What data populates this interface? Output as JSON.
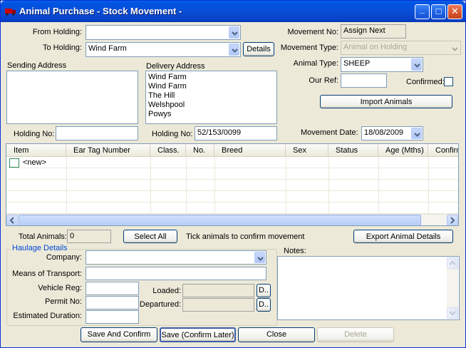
{
  "window": {
    "title": "Animal Purchase - Stock Movement -",
    "minimize": "_",
    "maximize": "□",
    "close": "✕"
  },
  "from_holding": {
    "label": "From Holding:",
    "value": ""
  },
  "to_holding": {
    "label": "To Holding:",
    "value": "Wind Farm",
    "details_label": "Details"
  },
  "movement_no": {
    "label": "Movement No:",
    "value": "Assign Next"
  },
  "movement_type": {
    "label": "Movement Type:",
    "value": "Animal on Holding"
  },
  "animal_type": {
    "label": "Animal Type:",
    "value": "SHEEP"
  },
  "our_ref": {
    "label": "Our Ref:",
    "value": ""
  },
  "confirmed": {
    "label": "Confirmed:",
    "checked": false
  },
  "import_animals": {
    "label": "Import Animals"
  },
  "sending_address": {
    "label": "Sending Address",
    "lines": []
  },
  "delivery_address": {
    "label": "Delivery Address",
    "lines": [
      "Wind Farm",
      "Wind Farm",
      "The Hill",
      "Welshpool",
      "Powys"
    ]
  },
  "sending_holding_no": {
    "label": "Holding No:",
    "value": ""
  },
  "delivery_holding_no": {
    "label": "Holding No:",
    "value": "52/153/0099"
  },
  "movement_date": {
    "label": "Movement Date:",
    "value": "18/08/2009"
  },
  "grid": {
    "columns": [
      "Item",
      "Ear Tag Number",
      "Class.",
      "No.",
      "Breed",
      "Sex",
      "Status",
      "Age (Mths)",
      "Confirm"
    ],
    "new_row_label": "<new>"
  },
  "total_animals": {
    "label": "Total Animals:",
    "value": "0"
  },
  "select_all": {
    "label": "Select All"
  },
  "hint": "Tick animals to confirm movement",
  "export_details": {
    "label": "Export Animal Details"
  },
  "haulage": {
    "title": "Haulage Details",
    "company_label": "Company:",
    "company_value": "",
    "transport_label": "Means of Transport:",
    "transport_value": "",
    "vehicle_reg_label": "Vehicle Reg:",
    "vehicle_reg_value": "",
    "permit_no_label": "Permit No:",
    "permit_no_value": "",
    "duration_label": "Estimated Duration:",
    "duration_value": "",
    "loaded_label": "Loaded:",
    "loaded_value": "",
    "departured_label": "Departured:",
    "departured_value": "",
    "date_btn_label": "D.."
  },
  "notes": {
    "label": "Notes:",
    "value": ""
  },
  "buttons": {
    "save_confirm": "Save And Confirm",
    "save_later": "Save (Confirm Later)",
    "close": "Close",
    "delete": "Delete"
  },
  "colors": {
    "title_bar": "#0054e3",
    "window_bg": "#ece9d8",
    "field_border": "#7f9db9",
    "group_title": "#0046d5"
  }
}
